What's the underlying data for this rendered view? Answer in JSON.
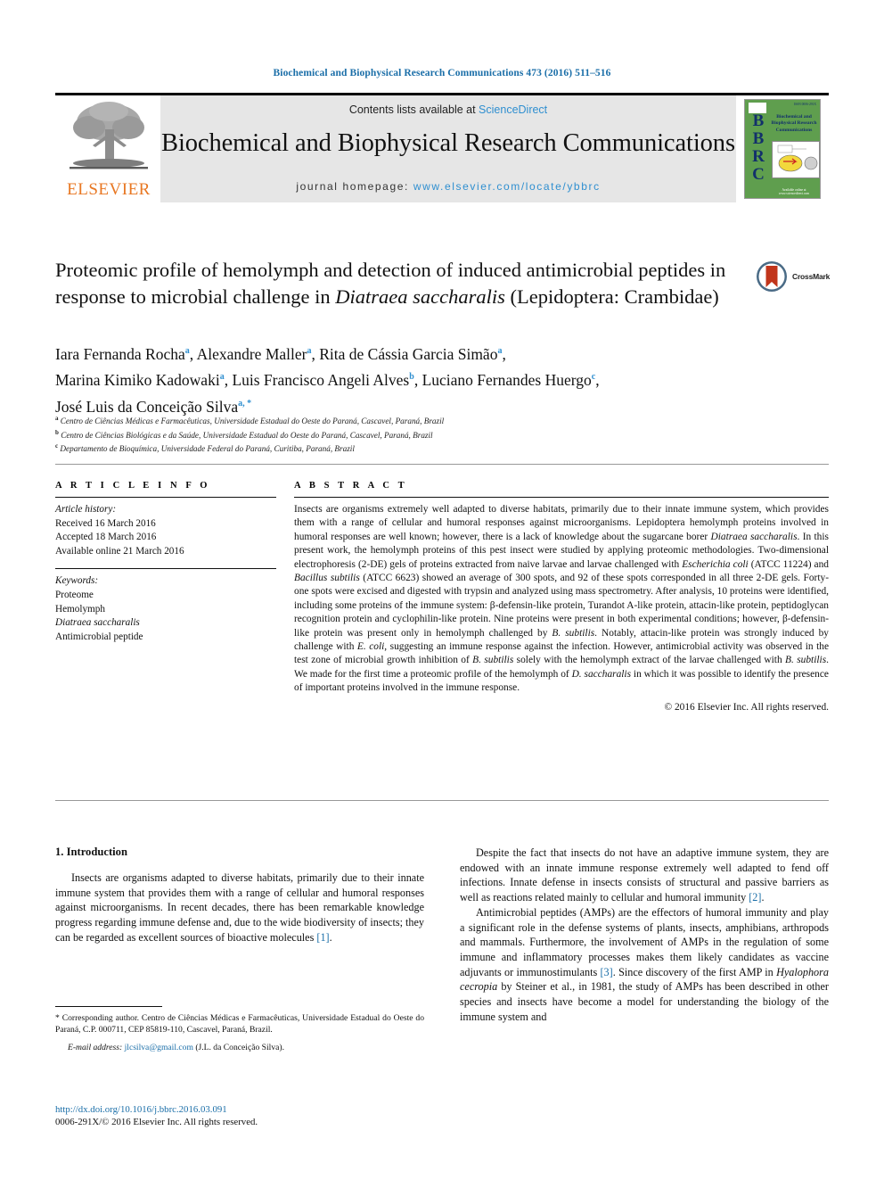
{
  "running_head": "Biochemical and Biophysical Research Communications 473 (2016) 511–516",
  "masthead": {
    "contents_prefix": "Contents lists available at ",
    "sciencedirect": "ScienceDirect",
    "journal_title": "Biochemical and Biophysical Research Communications",
    "homepage_prefix": "journal homepage: ",
    "homepage_url": "www.elsevier.com/locate/ybbrc",
    "elsevier_wordmark": "ELSEVIER",
    "cover": {
      "letters": "BBRC",
      "title_lines": "Biochemical and Biophysical Research Communications",
      "issn_top": "ISSN 0006-291X",
      "footer": "Available online at www.sciencedirect.com"
    },
    "accent_link_color": "#2f8fd0",
    "band_color": "#e6e6e6",
    "elsevier_orange": "#e87722"
  },
  "crossmark": {
    "label": "CrossMark"
  },
  "article": {
    "title_part1": "Proteomic profile of hemolymph and detection of induced antimicrobial peptides in response to microbial challenge in ",
    "title_italic1": "Diatraea saccharalis",
    "title_part2": " (Lepidoptera: Crambidae)",
    "authors_line1_a": "Iara Fernanda Rocha",
    "authors_line1_b": "Alexandre Maller",
    "authors_line1_c": "Rita de Cássia Garcia Simão",
    "authors_line2_a": "Marina Kimiko Kadowaki",
    "authors_line2_b": "Luis Francisco Angeli Alves",
    "authors_line2_c": "Luciano Fernandes Huergo",
    "authors_line3_a": "José Luis da Conceição Silva",
    "affiliation_a": "Centro de Ciências Médicas e Farmacêuticas, Universidade Estadual do Oeste do Paraná, Cascavel, Paraná, Brazil",
    "affiliation_b": "Centro de Ciências Biológicas e da Saúde, Universidade Estadual do Oeste do Paraná, Cascavel, Paraná, Brazil",
    "affiliation_c": "Departamento de Bioquímica, Universidade Federal do Paraná, Curitiba, Paraná, Brazil"
  },
  "article_info": {
    "heading": "A R T I C L E   I N F O",
    "history_label": "Article history:",
    "received": "Received 16 March 2016",
    "accepted": "Accepted 18 March 2016",
    "available": "Available online 21 March 2016",
    "keywords_label": "Keywords:",
    "keywords": [
      "Proteome",
      "Hemolymph",
      "Diatraea saccharalis",
      "Antimicrobial peptide"
    ]
  },
  "abstract": {
    "heading": "A B S T R A C T",
    "p1": "Insects are organisms extremely well adapted to diverse habitats, primarily due to their innate immune system, which provides them with a range of cellular and humoral responses against microorganisms. Lepidoptera hemolymph proteins involved in humoral responses are well known; however, there is a lack of knowledge about the sugarcane borer ",
    "sp1": "Diatraea saccharalis",
    "p2": ". In this present work, the hemolymph proteins of this pest insect were studied by applying proteomic methodologies. Two-dimensional electrophoresis (2-DE) gels of proteins extracted from naive larvae and larvae challenged with ",
    "sp2": "Escherichia coli",
    "p3": " (ATCC 11224) and ",
    "sp3": "Bacillus subtilis",
    "p4": " (ATCC 6623) showed an average of 300 spots, and 92 of these spots corresponded in all three 2-DE gels. Forty-one spots were excised and digested with trypsin and analyzed using mass spectrometry. After analysis, 10 proteins were identified, including some proteins of the immune system: β-defensin-like protein, Turandot A-like protein, attacin-like protein, peptidoglycan recognition protein and cyclophilin-like protein. Nine proteins were present in both experimental conditions; however, β-defensin-like protein was present only in hemolymph challenged by ",
    "sp4": "B. subtilis",
    "p5": ". Notably, attacin-like protein was strongly induced by challenge with ",
    "sp5": "E. coli",
    "p6": ", suggesting an immune response against the infection. However, antimicrobial activity was observed in the test zone of microbial growth inhibition of ",
    "sp6": "B. subtilis",
    "p7": " solely with the hemolymph extract of the larvae challenged with ",
    "sp7": "B. subtilis",
    "p8": ". We made for the first time a proteomic profile of the hemolymph of ",
    "sp8": "D. saccharalis",
    "p9": " in which it was possible to identify the presence of important proteins involved in the immune response.",
    "copyright": "© 2016 Elsevier Inc. All rights reserved."
  },
  "introduction": {
    "heading": "1. Introduction",
    "left_p1_a": "Insects are organisms adapted to diverse habitats, primarily due to their innate immune system that provides them with a range of cellular and humoral responses against microorganisms. In recent decades, there has been remarkable knowledge progress regarding immune defense and, due to the wide biodiversity of insects; they can be regarded as excellent sources of bioactive molecules ",
    "left_p1_ref": "[1]",
    "left_p1_b": ".",
    "right_p1_a": "Despite the fact that insects do not have an adaptive immune system, they are endowed with an innate immune response extremely well adapted to fend off infections. Innate defense in insects consists of structural and passive barriers as well as reactions related mainly to cellular and humoral immunity ",
    "right_p1_ref": "[2]",
    "right_p1_b": ".",
    "right_p2_a": "Antimicrobial peptides (AMPs) are the effectors of humoral immunity and play a significant role in the defense systems of plants, insects, amphibians, arthropods and mammals. Furthermore, the involvement of AMPs in the regulation of some immune and inflammatory processes makes them likely candidates as vaccine adjuvants or immunostimulants ",
    "right_p2_ref": "[3]",
    "right_p2_b": ". Since discovery of the first AMP in ",
    "right_p2_sp": "Hyalophora cecropia",
    "right_p2_c": " by Steiner et al., in 1981, the study of AMPs has been described in other species and insects have become a model for understanding the biology of the immune system and"
  },
  "footnotes": {
    "corresponding_a": "* Corresponding author. Centro de Ciências Médicas e Farmacêuticas, Universidade Estadual do Oeste do Paraná, C.P. 000711, CEP 85819-110, Cascavel, Paraná, Brazil.",
    "email_label": "E-mail address:",
    "email": "jlcsilva@gmail.com",
    "email_owner": "(J.L. da Conceição Silva).",
    "doi": "http://dx.doi.org/10.1016/j.bbrc.2016.03.091",
    "issn": "0006-291X/© 2016 Elsevier Inc. All rights reserved."
  }
}
